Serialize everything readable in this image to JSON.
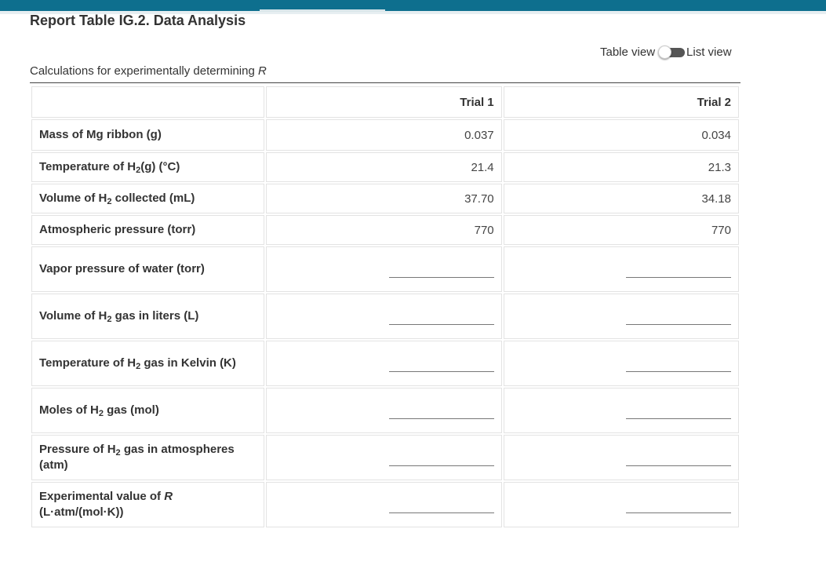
{
  "page": {
    "title": "Report Table IG.2. Data Analysis",
    "caption_prefix": "Calculations for experimentally determining ",
    "caption_var": "R"
  },
  "view_toggle": {
    "left_label": "Table view",
    "right_label": "List view",
    "state": "table"
  },
  "table": {
    "columns": [
      "Trial 1",
      "Trial 2"
    ],
    "given_rows": [
      {
        "pre": "Mass of Mg ribbon (g)",
        "sub": "",
        "post": "",
        "trial1": "0.037",
        "trial2": "0.034"
      },
      {
        "pre": "Temperature of H",
        "sub": "2",
        "post": "(g) (°C)",
        "trial1": "21.4",
        "trial2": "21.3"
      },
      {
        "pre": "Volume of H",
        "sub": "2",
        "post": " collected (mL)",
        "trial1": "37.70",
        "trial2": "34.18"
      },
      {
        "pre": "Atmospheric pressure (torr)",
        "sub": "",
        "post": "",
        "trial1": "770",
        "trial2": "770"
      }
    ],
    "calc_rows": [
      {
        "pre": "Vapor pressure of water (torr)",
        "sub": "",
        "post": "",
        "trial1": "",
        "trial2": ""
      },
      {
        "pre": "Volume of H",
        "sub": "2",
        "post": " gas in liters (L)",
        "trial1": "",
        "trial2": ""
      },
      {
        "pre": "Temperature of H",
        "sub": "2",
        "post": " gas in Kelvin (K)",
        "trial1": "",
        "trial2": ""
      },
      {
        "pre": "Moles of H",
        "sub": "2",
        "post": " gas (mol)",
        "trial1": "",
        "trial2": ""
      },
      {
        "pre": "Pressure of H",
        "sub": "2",
        "post": " gas in atmospheres (atm)",
        "trial1": "",
        "trial2": ""
      },
      {
        "pre": "Experimental value of ",
        "italic": "R",
        "post": " (L·atm/(mol·K))",
        "trial1": "",
        "trial2": ""
      }
    ]
  }
}
